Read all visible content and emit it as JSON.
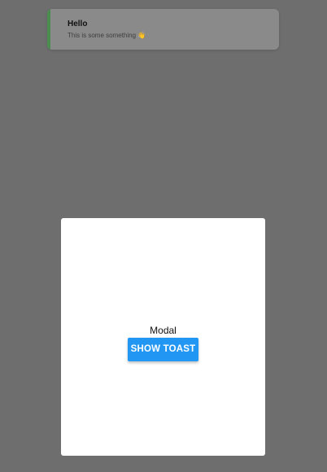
{
  "toast": {
    "title": "Hello",
    "message": "This is some something 👋",
    "accent_color": "#4a8e4f"
  },
  "modal": {
    "text": "Modal",
    "button_label": "SHOW TOAST",
    "button_color": "#2196f3"
  },
  "colors": {
    "overlay": "#6e6e6e",
    "modal_background": "#ffffff"
  }
}
